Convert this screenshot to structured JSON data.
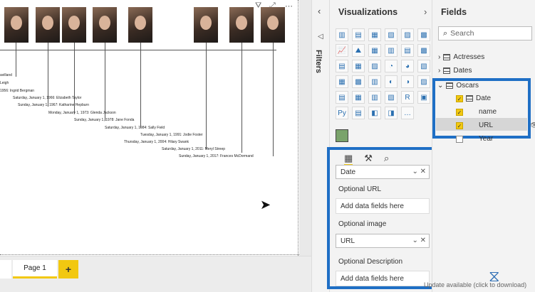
{
  "canvas": {
    "toolbar_icons": [
      "filter-icon",
      "focus-mode-icon",
      "more-options-icon"
    ],
    "events": [
      "avilland",
      "Leigh",
      "1956: Ingrid Bergman",
      "Saturday, January 1, 1966: Elizabeth Taylor",
      "Sunday, January 1, 1967: Katharine Hepburn",
      "Monday, January 1, 1973: Glenda Jackson",
      "Sunday, January 1, 1978: Jane Fonda",
      "Saturday, January 1, 1984: Sally Field",
      "Tuesday, January 1, 1991: Jodie Foster",
      "Thursday, January 1, 2004: Hilary Swank",
      "Saturday, January 1, 2011: Meryl Streep",
      "Sunday, January 1, 2017: Frances McDormand"
    ]
  },
  "pages": {
    "active": "Page 1",
    "add_label": "+"
  },
  "filters": {
    "label": "Filters"
  },
  "visualizations": {
    "title": "Visualizations",
    "icons": [
      "▥",
      "▤",
      "▦",
      "▧",
      "▨",
      "▩",
      "📈",
      "⛰",
      "▦",
      "▥",
      "▤",
      "▩",
      "▤",
      "▦",
      "▨",
      "◔",
      "◕",
      "▧",
      "▦",
      "▩",
      "▥",
      "◐",
      "◑",
      "▨",
      "▤",
      "▦",
      "▥",
      "▧",
      "R",
      "▣",
      "Py",
      "▤",
      "◧",
      "◨",
      "…"
    ],
    "wells": {
      "date_field": "Date",
      "url_label": "Optional URL",
      "url_placeholder": "Add data fields here",
      "image_label": "Optional image",
      "image_field": "URL",
      "description_label": "Optional Description",
      "description_placeholder": "Add data fields here"
    }
  },
  "fields": {
    "title": "Fields",
    "search_placeholder": "Search",
    "tables": [
      {
        "name": "Actresses"
      },
      {
        "name": "Dates"
      },
      {
        "name": "Oscars",
        "columns": [
          {
            "name": "Date",
            "checked": true
          },
          {
            "name": "name",
            "checked": true
          },
          {
            "name": "URL",
            "checked": true
          },
          {
            "name": "Year",
            "checked": false
          }
        ]
      }
    ]
  },
  "status": {
    "update_text": "Update available (click to download)"
  }
}
